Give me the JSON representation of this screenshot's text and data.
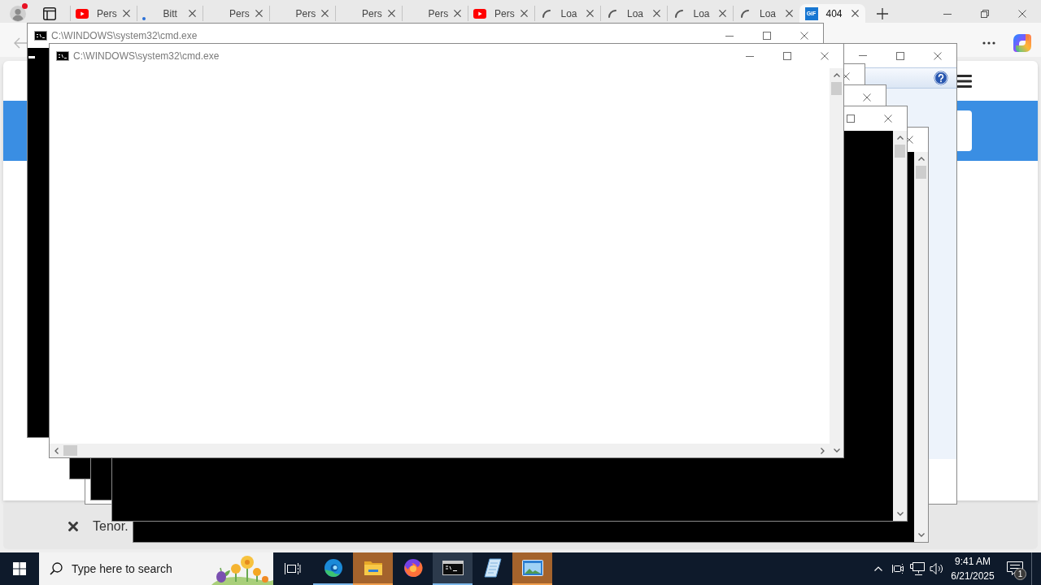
{
  "browser": {
    "tabs": [
      {
        "kind": "video",
        "title": "Pers",
        "selected": false
      },
      {
        "kind": "dot",
        "title": "Bitt",
        "selected": false
      },
      {
        "kind": "none",
        "title": "Pers",
        "selected": false
      },
      {
        "kind": "none",
        "title": "Pers",
        "selected": false
      },
      {
        "kind": "none",
        "title": "Pers",
        "selected": false
      },
      {
        "kind": "none",
        "title": "Pers",
        "selected": false
      },
      {
        "kind": "video",
        "title": "Pers",
        "selected": false
      },
      {
        "kind": "spinner",
        "title": "Loa",
        "selected": false
      },
      {
        "kind": "spinner",
        "title": "Loa",
        "selected": false
      },
      {
        "kind": "spinner",
        "title": "Loa",
        "selected": false
      },
      {
        "kind": "spinner",
        "title": "Loa",
        "selected": false
      },
      {
        "kind": "tile",
        "favicon_text": "GiF",
        "title": "404",
        "selected": true
      }
    ],
    "bottom_bar": {
      "text": "Tenor."
    }
  },
  "windows": [
    {
      "kind": "dialog"
    },
    {
      "kind": "console",
      "painted": true
    },
    {
      "kind": "console",
      "painted": true
    },
    {
      "kind": "console",
      "painted": true
    },
    {
      "kind": "console",
      "painted": true
    },
    {
      "kind": "console",
      "title": "C:\\WINDOWS\\system32\\cmd.exe",
      "painted": true
    },
    {
      "kind": "console",
      "title": "C:\\WINDOWS\\system32\\cmd.exe",
      "painted": false
    }
  ],
  "taskbar": {
    "search": {
      "placeholder": "Type here to search"
    },
    "apps": [
      {
        "kind": "swirl",
        "running": true,
        "active": false,
        "attention": false
      },
      {
        "kind": "folder",
        "running": true,
        "active": false,
        "attention": true
      },
      {
        "kind": "globe",
        "running": false,
        "active": false,
        "attention": false
      },
      {
        "kind": "terminal",
        "running": true,
        "active": true,
        "attention": false
      },
      {
        "kind": "notepad",
        "running": false,
        "active": false,
        "attention": false
      },
      {
        "kind": "window",
        "running": true,
        "active": false,
        "attention": true
      }
    ],
    "clock": {
      "time": "9:41 AM",
      "date": "6/21/2025"
    },
    "notifications": {
      "count": "1"
    }
  }
}
